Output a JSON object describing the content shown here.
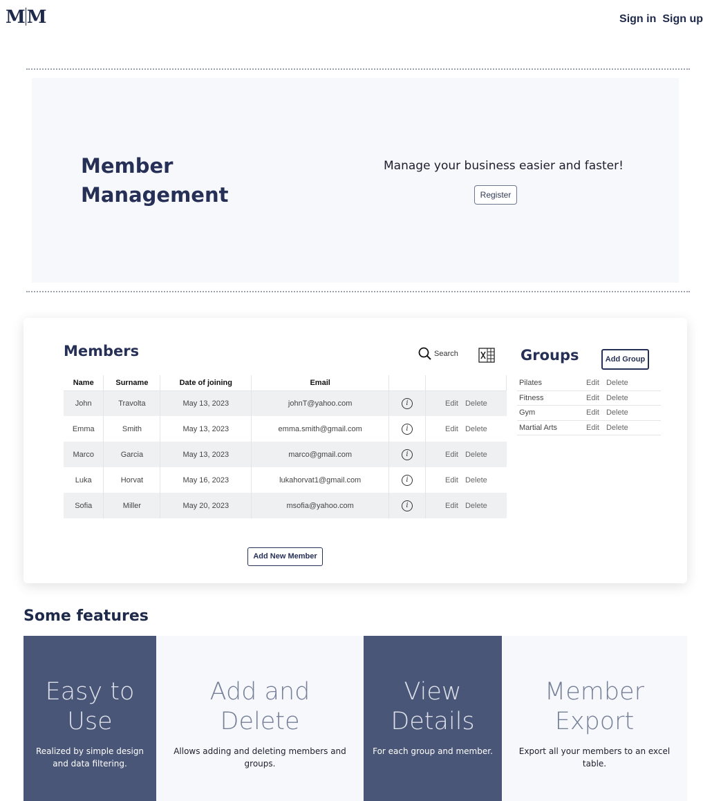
{
  "header": {
    "logo_left": "M",
    "logo_right": "M",
    "signin_label": "Sign in",
    "signup_label": "Sign up"
  },
  "hero": {
    "title": "Member Management",
    "tagline": "Manage your business easier and faster!",
    "register_label": "Register"
  },
  "members": {
    "title": "Members",
    "search_label": "Search",
    "export_icon": "excel-icon",
    "columns": [
      "Name",
      "Surname",
      "Date of joining",
      "Email"
    ],
    "rows": [
      {
        "name": "John",
        "surname": "Travolta",
        "date": "May 13, 2023",
        "email": "johnT@yahoo.com"
      },
      {
        "name": "Emma",
        "surname": "Smith",
        "date": "May 13, 2023",
        "email": "emma.smith@gmail.com"
      },
      {
        "name": "Marco",
        "surname": "Garcia",
        "date": "May 13, 2023",
        "email": "marco@gmail.com"
      },
      {
        "name": "Luka",
        "surname": "Horvat",
        "date": "May 16, 2023",
        "email": "lukahorvat1@gmail.com"
      },
      {
        "name": "Sofia",
        "surname": "Miller",
        "date": "May 20, 2023",
        "email": "msofia@yahoo.com"
      }
    ],
    "edit_label": "Edit",
    "delete_label": "Delete",
    "info_glyph": "i",
    "add_label": "Add New Member"
  },
  "groups": {
    "title": "Groups",
    "add_label": "Add Group",
    "items": [
      {
        "name": "Pilates"
      },
      {
        "name": "Fitness"
      },
      {
        "name": "Gym"
      },
      {
        "name": "Martial Arts"
      }
    ],
    "edit_label": "Edit",
    "delete_label": "Delete"
  },
  "features": {
    "title": "Some features",
    "items": [
      {
        "line1": "Easy to",
        "line2": "Use",
        "desc": "Realized by simple design and data filtering."
      },
      {
        "line1": "Add and",
        "line2": "Delete",
        "desc": "Allows adding and deleting members and groups."
      },
      {
        "line1": "View",
        "line2": "Details",
        "desc": "For each group and member."
      },
      {
        "line1": "Member",
        "line2": "Export",
        "desc": "Export all your members to an excel table."
      }
    ]
  },
  "colors": {
    "navy": "#263056",
    "feature_dark": "#4a5677",
    "feature_light": "#f7f8fb"
  }
}
